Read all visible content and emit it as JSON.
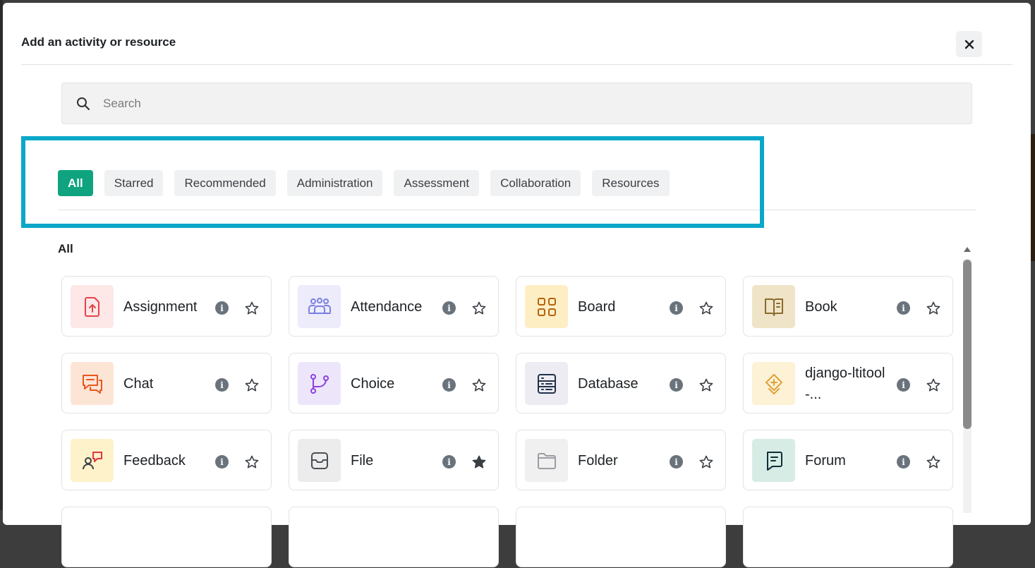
{
  "modal": {
    "title": "Add an activity or resource",
    "close_label": "✕"
  },
  "search": {
    "placeholder": "Search",
    "value": ""
  },
  "tabs": [
    {
      "label": "All",
      "active": true
    },
    {
      "label": "Starred",
      "active": false
    },
    {
      "label": "Recommended",
      "active": false
    },
    {
      "label": "Administration",
      "active": false
    },
    {
      "label": "Assessment",
      "active": false
    },
    {
      "label": "Collaboration",
      "active": false
    },
    {
      "label": "Resources",
      "active": false
    }
  ],
  "section": {
    "label": "All"
  },
  "activities": [
    {
      "name": "Assignment",
      "icon": "assignment-icon",
      "icon_bg": "#fde7e7",
      "icon_color": "#e8434b",
      "starred": false
    },
    {
      "name": "Attendance",
      "icon": "attendance-icon",
      "icon_bg": "#ececfb",
      "icon_color": "#7b7fe0",
      "starred": false
    },
    {
      "name": "Board",
      "icon": "board-icon",
      "icon_bg": "#fdeec4",
      "icon_color": "#b5630c",
      "starred": false
    },
    {
      "name": "Book",
      "icon": "book-icon",
      "icon_bg": "#efe4c8",
      "icon_color": "#8a6a2a",
      "starred": false
    },
    {
      "name": "Chat",
      "icon": "chat-icon",
      "icon_bg": "#fde5d6",
      "icon_color": "#e8561c",
      "starred": false
    },
    {
      "name": "Choice",
      "icon": "choice-icon",
      "icon_bg": "#ede6fb",
      "icon_color": "#8a3fe0",
      "starred": false
    },
    {
      "name": "Database",
      "icon": "database-icon",
      "icon_bg": "#ececf2",
      "icon_color": "#23304a",
      "starred": false
    },
    {
      "name": "django-ltitool-...",
      "icon": "lti-icon",
      "icon_bg": "#fdf1d6",
      "icon_color": "#e0a23a",
      "starred": false
    },
    {
      "name": "Feedback",
      "icon": "feedback-icon",
      "icon_bg": "#fdf2c9",
      "icon_color": "#e0373f",
      "starred": false
    },
    {
      "name": "File",
      "icon": "file-icon",
      "icon_bg": "#ececec",
      "icon_color": "#4a4f55",
      "starred": true
    },
    {
      "name": "Folder",
      "icon": "folder-icon",
      "icon_bg": "#f0f0f0",
      "icon_color": "#9a9ea3",
      "starred": false
    },
    {
      "name": "Forum",
      "icon": "forum-icon",
      "icon_bg": "#d7ece4",
      "icon_color": "#0f2f3a",
      "starred": false
    },
    {
      "name": "",
      "icon": "",
      "icon_bg": "#ffffff",
      "icon_color": "#ffffff",
      "starred": false
    },
    {
      "name": "",
      "icon": "",
      "icon_bg": "#ffffff",
      "icon_color": "#ffffff",
      "starred": false
    },
    {
      "name": "",
      "icon": "",
      "icon_bg": "#ffffff",
      "icon_color": "#ffffff",
      "starred": false
    },
    {
      "name": "",
      "icon": "",
      "icon_bg": "#ffffff",
      "icon_color": "#ffffff",
      "starred": false
    }
  ],
  "info_glyph": "i",
  "colors": {
    "active_tab": "#0fa37f",
    "highlight": "#0aa7c9"
  }
}
